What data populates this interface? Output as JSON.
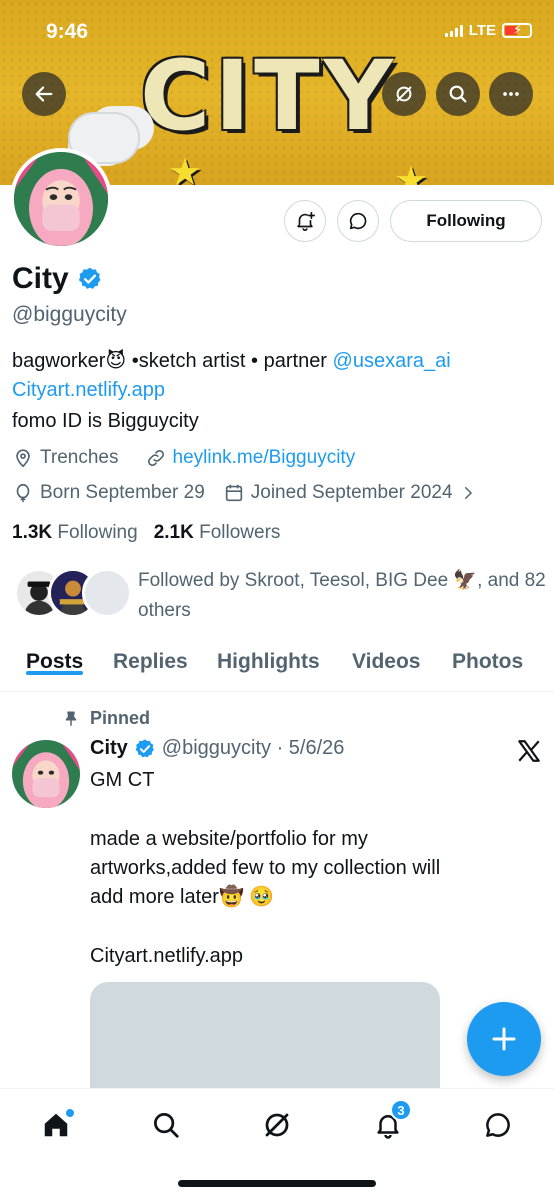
{
  "status_bar": {
    "time": "9:46",
    "network": "LTE"
  },
  "banner": {
    "logo_text": "CITY"
  },
  "header_actions": {
    "back": "back-arrow",
    "grok": "grok-icon",
    "search": "search-icon",
    "more": "more-icon"
  },
  "profile": {
    "name": "City",
    "handle": "@bigguycity",
    "bio_line1_text": "bagworker😈 •sketch artist • partner ",
    "bio_line1_mention": "@usexara_ai",
    "bio_link": "Cityart.netlify.app",
    "bio_line3": "fomo ID is Bigguycity",
    "location": "Trenches",
    "website": "heylink.me/Bigguycity",
    "birthday": "Born September 29",
    "joined": "Joined September 2024",
    "following_count": "1.3K",
    "following_label": "Following",
    "followers_count": "2.1K",
    "followers_label": "Followers",
    "followed_by": "Followed by Skroot, Teesol, BIG Dee 🦅, and 82 others",
    "follow_button": "Following"
  },
  "tabs": [
    "Posts",
    "Replies",
    "Highlights",
    "Videos",
    "Photos"
  ],
  "tweet": {
    "pinned_label": "Pinned",
    "name": "City",
    "handle_date": "@bigguycity · 5/6/26",
    "line1": "GM CT",
    "line2": "made a website/portfolio for my",
    "line3": "artworks,added few to my collection will",
    "line4": "add more later🤠 🥹",
    "link": "Cityart.netlify.app"
  },
  "bottom_nav": {
    "notifications_badge": "3"
  },
  "colors": {
    "accent": "#1d9bf0",
    "banner": "#e6b62a",
    "text": "#0f1419",
    "muted": "#536471"
  }
}
